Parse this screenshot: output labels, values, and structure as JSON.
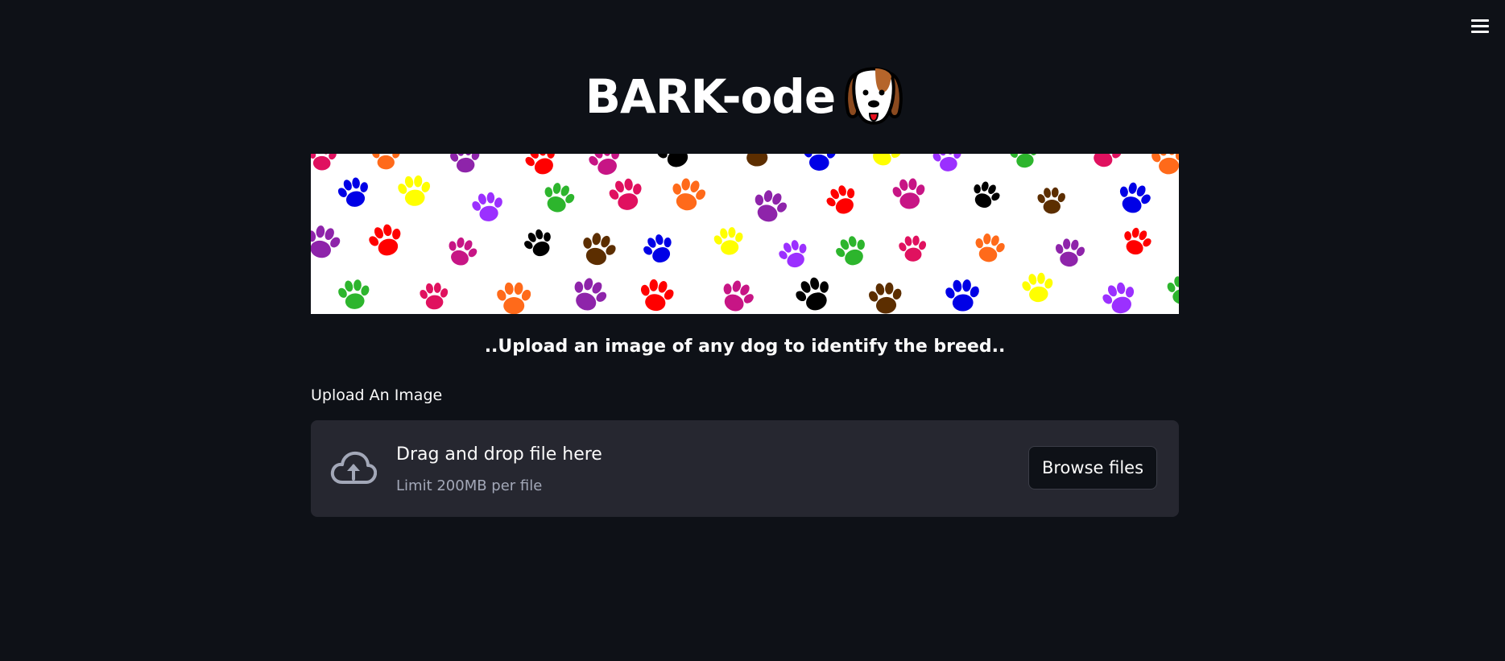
{
  "app": {
    "menu_icon": "hamburger-menu-icon"
  },
  "header": {
    "title": "BARK-ode",
    "emoji_icon": "dog-face-icon"
  },
  "banner": {
    "pattern_icon": "paw-print-icon",
    "paw_colors": [
      "#e0115f",
      "#9b30ff",
      "#0000e6",
      "#000000",
      "#ff0000",
      "#ff6a1a",
      "#2db52d",
      "#ffff00",
      "#5c2e00",
      "#c71585",
      "#8e24aa"
    ]
  },
  "main": {
    "subtitle": "..Upload an image of any dog to identify the breed..",
    "upload_label": "Upload An Image"
  },
  "uploader": {
    "icon": "cloud-upload-icon",
    "drop_text": "Drag and drop file here",
    "limit_text": "Limit 200MB per file",
    "button_label": "Browse files"
  },
  "colors": {
    "background": "#0e1117",
    "dropzone": "#262730",
    "text": "#fafafa",
    "muted": "#a3a8b8"
  }
}
